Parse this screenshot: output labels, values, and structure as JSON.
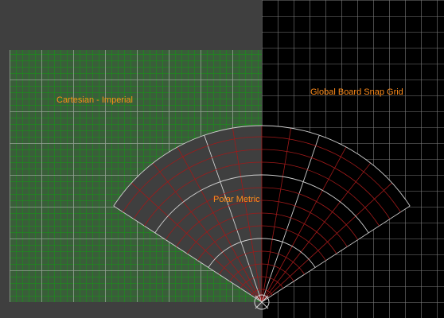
{
  "canvas": {
    "background_color": "#3f3f3f",
    "global_background_color": "#000000"
  },
  "regions": {
    "cartesian": {
      "label": "Cartesian - Imperial",
      "fill_color": "#3a5e3a",
      "major_line_color": "#9a9a9a",
      "minor_line_color": "#1f8a1f"
    },
    "global": {
      "label": "Global Board Snap Grid",
      "line_color": "#7d7d7d"
    },
    "polar": {
      "label": "Polar Metric",
      "major_line_color": "#cfcfcf",
      "minor_line_color": "#a01a1a"
    }
  },
  "label_color": "#ff8c1a",
  "origin_marker_icon": "crosshair-circle-icon"
}
